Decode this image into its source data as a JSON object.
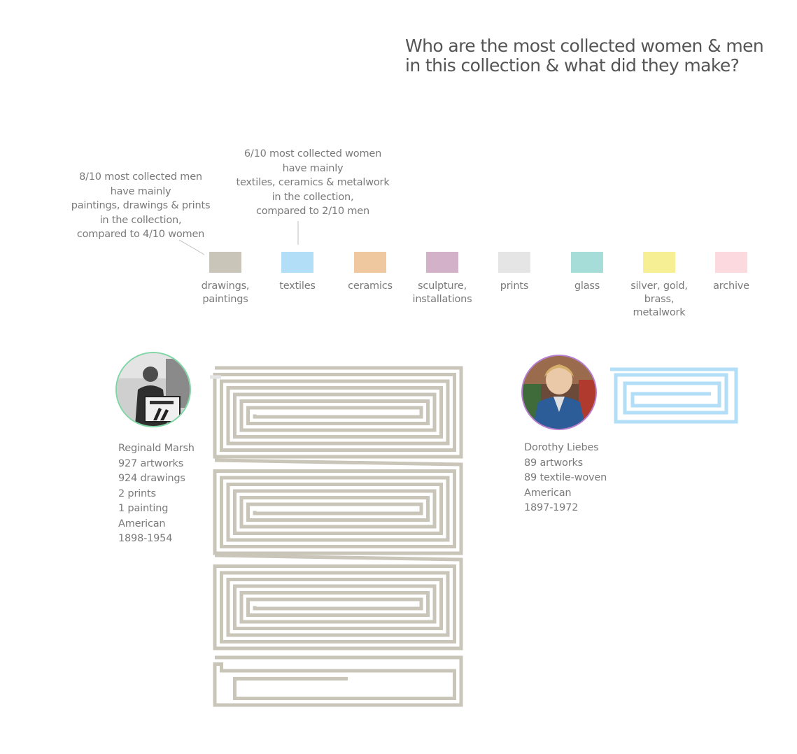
{
  "title": {
    "line1": "Who are the most collected women & men",
    "line2": "in this collection & what did they make?"
  },
  "annotations": {
    "men": [
      "8/10 most collected men",
      "have mainly",
      "paintings, drawings & prints",
      "in the collection,",
      "compared to 4/10 women"
    ],
    "women": [
      "6/10 most collected women",
      "have mainly",
      "textiles, ceramics & metalwork",
      "in the collection,",
      "compared to 2/10 men"
    ]
  },
  "chart_data": {
    "type": "other",
    "legend": [
      {
        "lines": [
          "drawings,",
          "paintings"
        ],
        "color": "#c9c5b9"
      },
      {
        "lines": [
          "textiles"
        ],
        "color": "#b3def8"
      },
      {
        "lines": [
          "ceramics"
        ],
        "color": "#efc8a0"
      },
      {
        "lines": [
          "sculpture,",
          "installations"
        ],
        "color": "#d3b1c9"
      },
      {
        "lines": [
          "prints"
        ],
        "color": "#e5e5e5"
      },
      {
        "lines": [
          "glass"
        ],
        "color": "#a6ddd8"
      },
      {
        "lines": [
          "silver, gold,",
          "brass,",
          "metalwork"
        ],
        "color": "#f7ef94"
      },
      {
        "lines": [
          "archive"
        ],
        "color": "#fcd9df"
      }
    ],
    "people": [
      {
        "name": "Reginald Marsh",
        "gender": "man",
        "artworks": 927,
        "info": [
          "927 artworks",
          "924 drawings",
          "2 prints",
          "1 painting",
          "American",
          "1898-1954"
        ],
        "ring_color": "#7fd6a5",
        "segments": [
          {
            "category": "drawings, paintings",
            "count": 925,
            "color": "#c9c5b9"
          },
          {
            "category": "prints",
            "count": 2,
            "color": "#e5e5e5"
          }
        ]
      },
      {
        "name": "Dorothy Liebes",
        "gender": "woman",
        "artworks": 89,
        "info": [
          "89 artworks",
          "89 textile-woven",
          "American",
          "1897-1972"
        ],
        "ring_color": "#b77dd0",
        "segments": [
          {
            "category": "textiles",
            "count": 89,
            "color": "#b3def8"
          }
        ]
      }
    ]
  }
}
